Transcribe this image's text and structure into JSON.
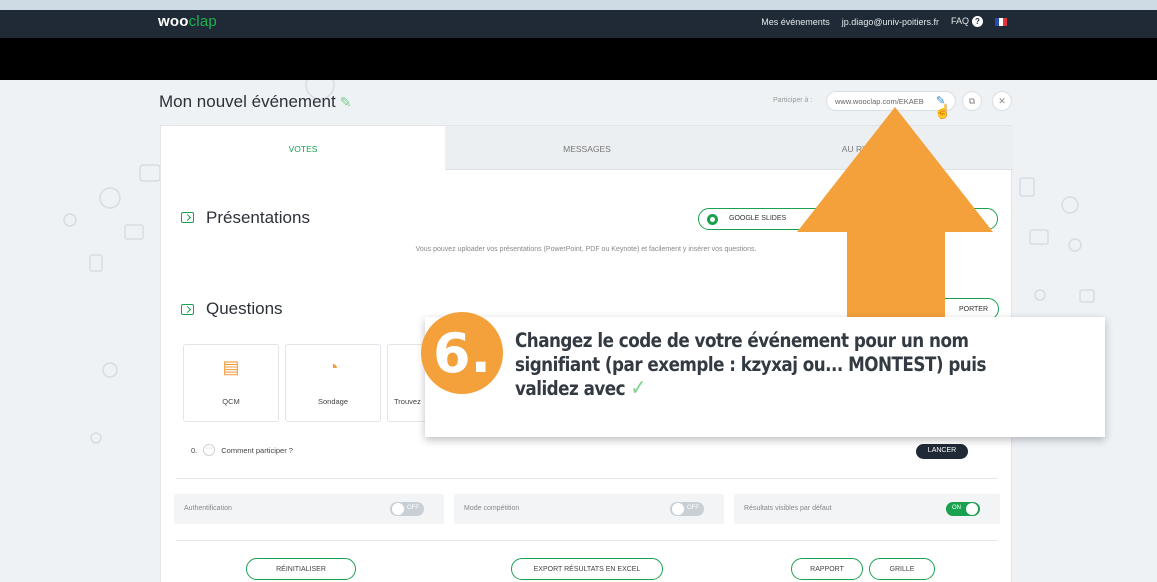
{
  "app": {
    "logo_part1": "woo",
    "logo_part2": "clap"
  },
  "topnav": {
    "my_events": "Mes événements",
    "user_email": "jp.diago@univ-poitiers.fr",
    "faq": "FAQ",
    "faq_icon": "question-circle-icon",
    "language_flag": "french-flag-icon"
  },
  "event": {
    "title": "Mon nouvel événement",
    "participate_label": "Participer à :",
    "code_value": "www.wooclap.com/EKAEB",
    "copy_icon": "copy-icon",
    "close_icon": "close-icon"
  },
  "tabs": [
    {
      "label": "VOTES",
      "active": true
    },
    {
      "label": "MESSAGES",
      "active": false
    },
    {
      "label": "AU RYTHME D",
      "active": false
    }
  ],
  "presentations": {
    "title": "Présentations",
    "google_button": "GOOGLE SLIDES",
    "upload_text": "Vous pouvez uploader vos présentations (PowerPoint, PDF ou Keynote) et facilement y insérer vos questions."
  },
  "questions": {
    "title": "Questions",
    "import_button": "PORTER",
    "types": [
      {
        "label": "QCM",
        "icon": "qcm-icon"
      },
      {
        "label": "Sondage",
        "icon": "poll-icon"
      },
      {
        "label": "Trouvez",
        "icon": "find-icon"
      }
    ],
    "list": [
      {
        "number": "0.",
        "label": "Comment participer ?",
        "action": "LANCER"
      }
    ]
  },
  "options": [
    {
      "label": "Authentification",
      "state": "OFF"
    },
    {
      "label": "Mode compétition",
      "state": "OFF"
    },
    {
      "label": "Résultats visibles par défaut",
      "state": "ON"
    }
  ],
  "bottom_buttons": {
    "reset": "RÉINITIALISER",
    "export": "EXPORT RÉSULTATS EN EXCEL",
    "report": "RAPPORT",
    "grid": "GRILLE"
  },
  "instruction": {
    "step": "6.",
    "text": "Changez le code de votre événement pour un nom signifiant (par exemple : kzyxaj ou... MONTEST) puis validez avec",
    "check": "✓"
  },
  "colors": {
    "brand_green": "#1aa150",
    "topbar": "#1f2a36",
    "arrow_orange": "#f4a13b",
    "step_orange": "#f4a13b"
  }
}
